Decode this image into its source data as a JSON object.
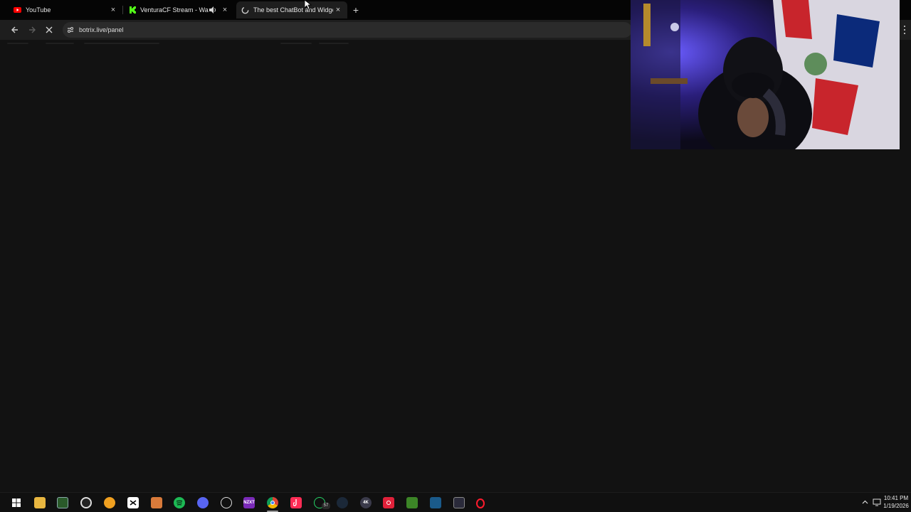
{
  "browser": {
    "tabs": [
      {
        "title": "YouTube",
        "favicon": "youtube-icon",
        "active": false,
        "audio": false
      },
      {
        "title": "VenturaCF Stream - Watch Li",
        "favicon": "kick-icon",
        "active": false,
        "audio": true
      },
      {
        "title": "The best ChatBot and Widgets",
        "favicon": "loading-globe-icon",
        "active": true,
        "audio": false
      }
    ],
    "new_tab_label": "+",
    "close_glyph": "×",
    "url": "botrix.live/panel",
    "loading": true
  },
  "taskbar": {
    "icons": [
      "windows-start-icon",
      "file-explorer-icon",
      "spreadsheet-icon",
      "obs-icon",
      "folder-app-icon",
      "capcut-icon",
      "streamer-app-icon",
      "spotify-icon",
      "discord-icon",
      "clip-tool-icon",
      "nzxt-icon",
      "chrome-icon",
      "tiktok-icon",
      "whatsapp-icon",
      "steam-icon",
      "4k-downloader-icon",
      "record-app-icon",
      "minecraft-icon",
      "lightning-app-icon",
      "elgato-icon",
      "opera-icon"
    ],
    "nzxt_label": "NZXT",
    "fourk_label": "4K",
    "whatsapp_badge": "57",
    "clock": {
      "time": "10:41 PM",
      "date": "1/19/2026"
    }
  },
  "colors": {
    "page_bg": "#121212",
    "tabstrip_bg": "#050505",
    "toolbar_bg": "#1e1e1e",
    "youtube_red": "#ff0000",
    "kick_green": "#53fc18",
    "spotify_green": "#1db954"
  }
}
